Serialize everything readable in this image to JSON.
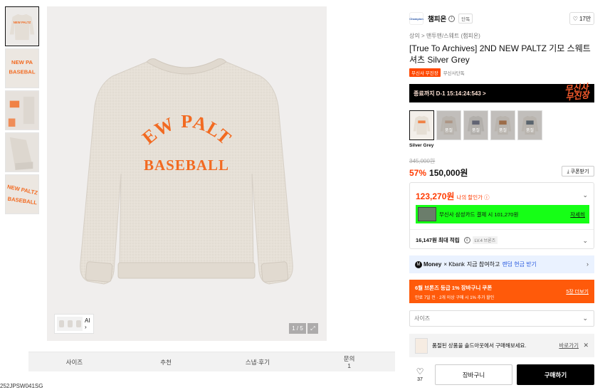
{
  "gallery": {
    "thumbnails": [
      {
        "alt": "front"
      },
      {
        "alt": "print-closeup"
      },
      {
        "alt": "cuff-detail"
      },
      {
        "alt": "sleeve-detail"
      },
      {
        "alt": "print-angle"
      }
    ],
    "main_print_line1": "NEW PALTZ",
    "main_print_line2": "BASEBALL",
    "thumb_print_line1": "NEW PALTZ",
    "thumb_print_line2": "BASEBALL",
    "ai_label": "AI",
    "counter": "1 / 5",
    "print_color": "#f26a21"
  },
  "tabs": [
    {
      "label": "사이즈",
      "count": ""
    },
    {
      "label": "추천",
      "count": ""
    },
    {
      "label": "스냅·후기",
      "count": ""
    },
    {
      "label": "문의",
      "count": "1"
    }
  ],
  "product_code": "252JPSW041SG",
  "brand": {
    "logo_text": "Champion",
    "name": "챔피온",
    "exclusive": "단독",
    "likes": "17만"
  },
  "breadcrumb": "상의 > 맨투맨/스웨트 (챔피온)",
  "title": "[True To Archives] 2ND NEW PALTZ 기모 스웨트셔츠 Silver Grey",
  "badges": {
    "orange": "무신사 무진장",
    "gray": "무신사단독"
  },
  "timer": {
    "text": "종료까지 D-1 15:14:24:543 >",
    "brand_line1": "무신사",
    "brand_line2": "무진장"
  },
  "colors": {
    "selected_name": "Silver Grey",
    "sold_out_label": "품절",
    "options": [
      {
        "name": "Silver Grey",
        "sold_out": false
      },
      {
        "name": "",
        "sold_out": true
      },
      {
        "name": "",
        "sold_out": true
      },
      {
        "name": "",
        "sold_out": true
      },
      {
        "name": "",
        "sold_out": true
      }
    ]
  },
  "pricing": {
    "original": "345,000원",
    "discount": "57%",
    "price": "150,000원",
    "coupon_button": "⤓ 쿠폰받기",
    "final_price": "123,270원",
    "final_label": "나의 할인가 ⓘ",
    "card_offer": "무신사 삼성카드 결제 시 101,270원",
    "card_link": "자세히",
    "points": "16,147원 최대 적립",
    "points_level": "LV.4 브론즈"
  },
  "money_banner": {
    "brand": "Money",
    "partner": "× Kbank",
    "text": "지금 참여하고",
    "link": "랜덤 현금 받기"
  },
  "coupon_banner": {
    "title": "6월 브론즈 등급 1% 장바구니 쿠폰",
    "subtitle": "만료 7일 전 · 2개 이상 구매 시 1% 추가 할인",
    "more": "5장 더보기"
  },
  "size_select": {
    "placeholder": "사이즈"
  },
  "outlet_banner": {
    "text": "품절된 상품을 솔드아웃에서 구매해보세요.",
    "link": "바로가기"
  },
  "actions": {
    "like_count": "37",
    "cart": "장바구니",
    "buy": "구매하기"
  },
  "colors_theme": {
    "accent": "#ff3b00",
    "card_highlight": "#16ff16",
    "coupon_banner": "#ff5a0a",
    "money_banner": "#eaf2ff"
  }
}
